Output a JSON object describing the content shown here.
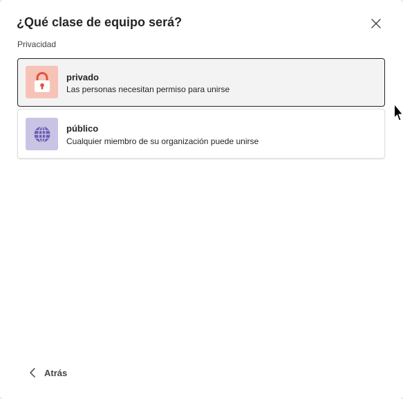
{
  "dialog": {
    "title": "¿Qué clase de equipo será?",
    "section_label": "Privacidad"
  },
  "options": [
    {
      "title": "privado",
      "description": "Las personas necesitan permiso para unirse",
      "icon": "lock-icon",
      "selected": true,
      "icon_bg": "#f7c3b7",
      "icon_color": "#e0533d"
    },
    {
      "title": "público",
      "description": "Cualquier miembro de su organización puede unirse",
      "icon": "globe-icon",
      "selected": false,
      "icon_bg": "#cac4e4",
      "icon_color": "#6b5fb5"
    }
  ],
  "footer": {
    "back_label": "Atrás"
  }
}
